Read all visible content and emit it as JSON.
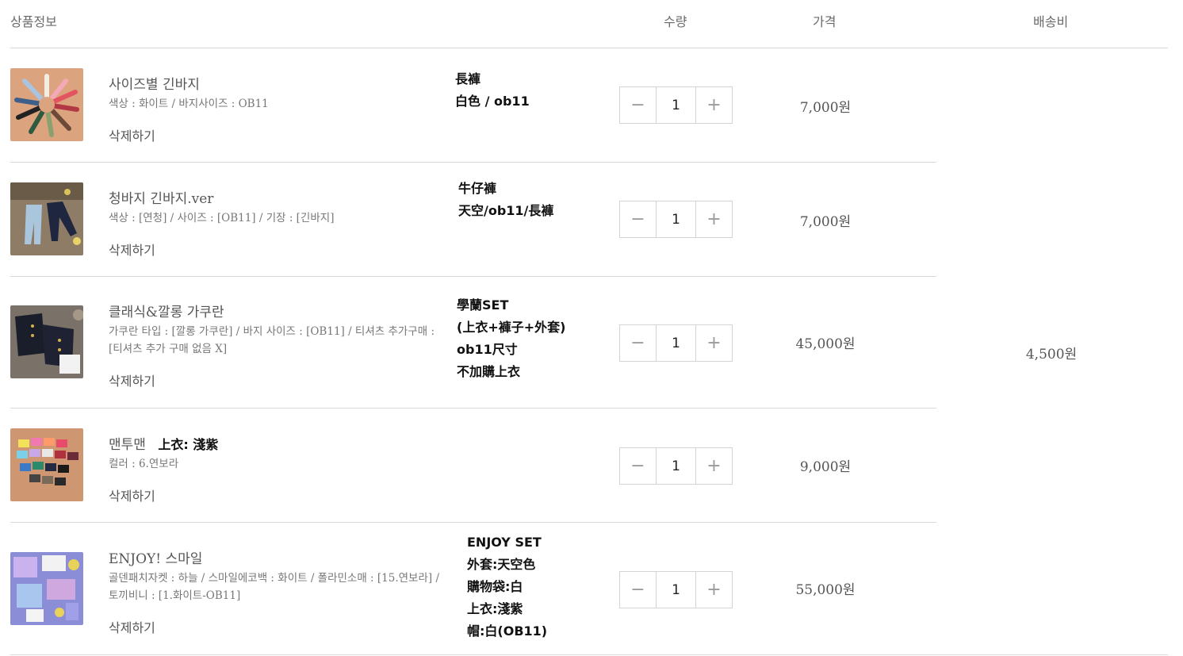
{
  "header": {
    "product_info": "상품정보",
    "quantity": "수량",
    "price": "가격",
    "shipping": "배송비"
  },
  "shipping_fee": "4,500원",
  "items": [
    {
      "name": "사이즈별 긴바지",
      "options": "색상 : 화이트 / 바지사이즈 : OB11",
      "delete": "삭제하기",
      "quantity": "1",
      "price": "7,000원",
      "note": [
        "長褲",
        "白色 / ob11"
      ],
      "thumb_colors": [
        "#d9a07a",
        "#e8bfa0"
      ]
    },
    {
      "name": "청바지 긴바지.ver",
      "options": "색상 : [연청] / 사이즈 : [OB11] / 기장 : [긴바지]",
      "delete": "삭제하기",
      "quantity": "1",
      "price": "7,000원",
      "note": [
        "牛仔褲",
        "天空/ob11/長褲"
      ],
      "thumb_colors": [
        "#8c7a66",
        "#b3a48f"
      ]
    },
    {
      "name": "클래식&깔롱 가쿠란",
      "options": "가쿠란 타입 : [깔롱 가쿠란] / 바지 사이즈 : [OB11] / 티셔츠 추가구매 : [티셔츠 추가 구매 없음 X]",
      "delete": "삭제하기",
      "quantity": "1",
      "price": "45,000원",
      "note": [
        "學蘭SET",
        "(上衣+褲子+外套)",
        "ob11尺寸",
        "不加購上衣"
      ],
      "thumb_colors": [
        "#6e655c",
        "#9a8f84"
      ]
    },
    {
      "name": "맨투맨",
      "name_note": "上衣: 淺紫",
      "options": "컬러 : 6.연보라",
      "delete": "삭제하기",
      "quantity": "1",
      "price": "9,000원",
      "note": [],
      "thumb_colors": [
        "#c9906a",
        "#dba584"
      ]
    },
    {
      "name": "ENJOY!   스마일",
      "options": "골덴패치자켓 : 하늘 / 스마일에코백 : 화이트 / 폴라민소매 : [15.연보라] / 토끼비니 : [1.화이트-OB11]",
      "delete": "삭제하기",
      "quantity": "1",
      "price": "55,000원",
      "note": [
        "ENJOY SET",
        "外套:天空色",
        "購物袋:白",
        "上衣:淺紫",
        "帽:白(OB11)"
      ],
      "thumb_colors": [
        "#8e8fd6",
        "#b7b0e6"
      ]
    }
  ],
  "icons": {
    "minus": "minus-icon",
    "plus": "plus-icon"
  },
  "colors": {
    "divider": "#d9d9d9",
    "text": "#555555",
    "note_text": "#111111"
  }
}
